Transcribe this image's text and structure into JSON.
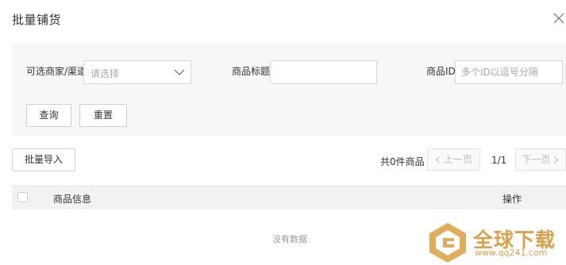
{
  "dialog": {
    "title": "批量铺货",
    "close_icon": "close-icon"
  },
  "filters": {
    "merchant": {
      "label": "可选商家/渠道",
      "placeholder": "请选择",
      "arrow_icon": "chevron-down-icon"
    },
    "product_title": {
      "label": "商品标题",
      "value": ""
    },
    "product_id": {
      "label": "商品ID",
      "placeholder": "多个ID以逗号分隔",
      "value": ""
    },
    "query_label": "查询",
    "reset_label": "重置"
  },
  "toolbar": {
    "import_label": "批量导入",
    "total_text": "共0件商品",
    "prev_label": "上一页",
    "page_indicator": "1/1",
    "next_label": "下一页"
  },
  "table": {
    "columns": [
      "商品信息",
      "操作"
    ],
    "empty_text": "没有数据"
  },
  "watermark": {
    "title": "全球下载",
    "url": "www.qq241.com",
    "color": "#d9a14a"
  },
  "colors": {
    "panel_bg": "#f7f7f8",
    "header_bg": "#f2f2f2",
    "border": "#d7d7d7"
  }
}
